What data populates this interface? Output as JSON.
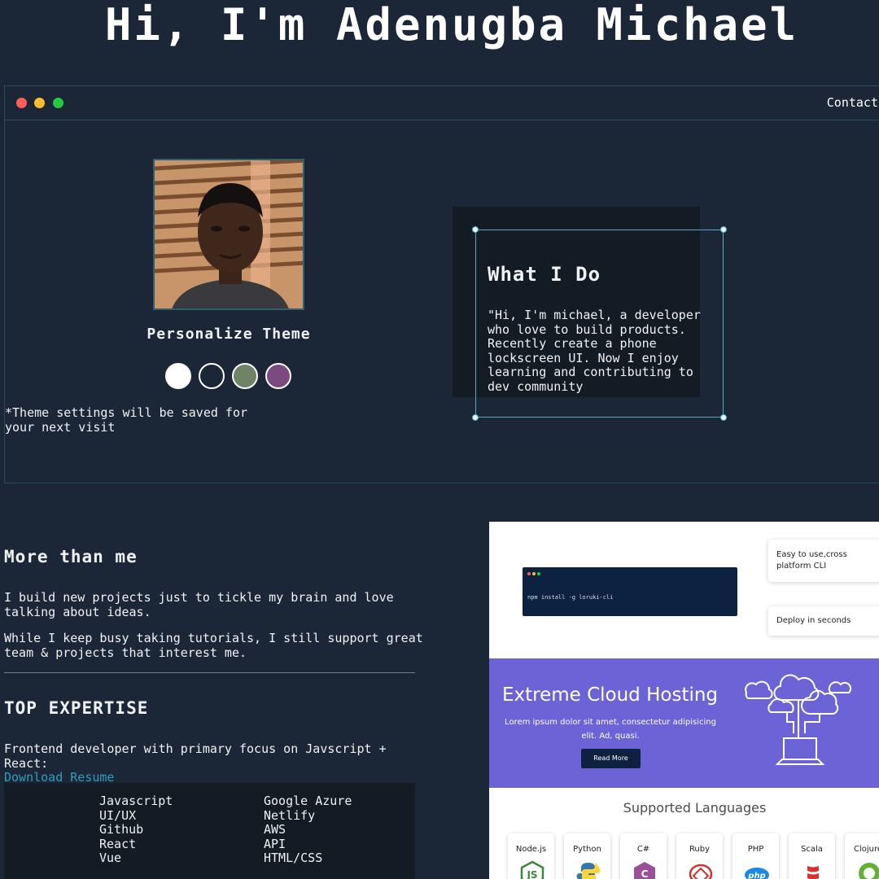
{
  "header": {
    "title": "Hi, I'm Adenugba Michael"
  },
  "window": {
    "nav_link": "Contact"
  },
  "profile": {
    "theme_title": "Personalize Theme",
    "theme_note": "*Theme settings will be saved for your next visit",
    "swatches": [
      {
        "name": "white",
        "color": "#ffffff"
      },
      {
        "name": "dark",
        "color": "#1b2636"
      },
      {
        "name": "sage",
        "color": "#6f8466"
      },
      {
        "name": "purple",
        "color": "#7b4a80"
      }
    ]
  },
  "what_i_do": {
    "title": "What I Do",
    "text": "\"Hi, I'm michael, a developer who love to build products. Recently create a phone lockscreen UI. Now I enjoy learning and contributing to dev community"
  },
  "more": {
    "title": "More than me",
    "p1": "I build new projects just to tickle my brain and love talking about ideas.",
    "p2": "While I keep busy taking tutorials, I still support great team & projects that interest me."
  },
  "expertise": {
    "title": "TOP EXPERTISE",
    "text": "Frontend developer with primary focus on Javscript + React:",
    "resume_link": "Download Resume",
    "skills_left": [
      "Javascript",
      "UI/UX",
      "Github",
      "React",
      "Vue"
    ],
    "skills_right": [
      "Google Azure",
      "Netlify",
      "AWS",
      "API",
      "HTML/CSS"
    ]
  },
  "project_shot": {
    "terminal_cmd": "npm install -g loruki-cli",
    "feature1": "Easy to use,cross platform CLI",
    "feature2": "Deploy in seconds",
    "hero_title": "Extreme Cloud Hosting",
    "hero_text": "Lorem ipsum dolor sit amet, consectetur adipisicing elit. Ad, quasi.",
    "hero_button": "Read More",
    "languages_title": "Supported Languages",
    "languages": [
      "Node.js",
      "Python",
      "C#",
      "Ruby",
      "PHP",
      "Scala",
      "Clojure"
    ],
    "accent": "#6b63d6",
    "navy": "#0d2240"
  }
}
